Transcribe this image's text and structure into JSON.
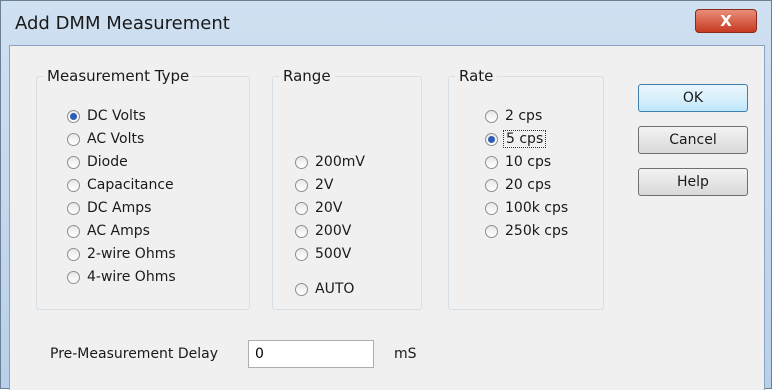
{
  "window": {
    "title": "Add DMM Measurement",
    "close_glyph": "X"
  },
  "measurement_type": {
    "label": "Measurement Type",
    "selected": "DC Volts",
    "options": [
      "DC Volts",
      "AC Volts",
      "Diode",
      "Capacitance",
      "DC Amps",
      "AC Amps",
      "2-wire Ohms",
      "4-wire Ohms"
    ]
  },
  "range": {
    "label": "Range",
    "options": [
      "200mV",
      "2V",
      "20V",
      "200V",
      "500V"
    ],
    "auto_label": "AUTO"
  },
  "rate": {
    "label": "Rate",
    "selected": "5 cps",
    "options": [
      "2 cps",
      "5 cps",
      "10 cps",
      "20 cps",
      "100k cps",
      "250k cps"
    ]
  },
  "buttons": {
    "ok": "OK",
    "cancel": "Cancel",
    "help": "Help"
  },
  "delay": {
    "label": "Pre-Measurement Delay",
    "value": "0",
    "unit": "mS"
  },
  "colors": {
    "title_bar": "#cfe0f1",
    "close_button": "#c63a22",
    "radio_selected": "#2b5db8",
    "ok_button": "#bee6fd"
  }
}
